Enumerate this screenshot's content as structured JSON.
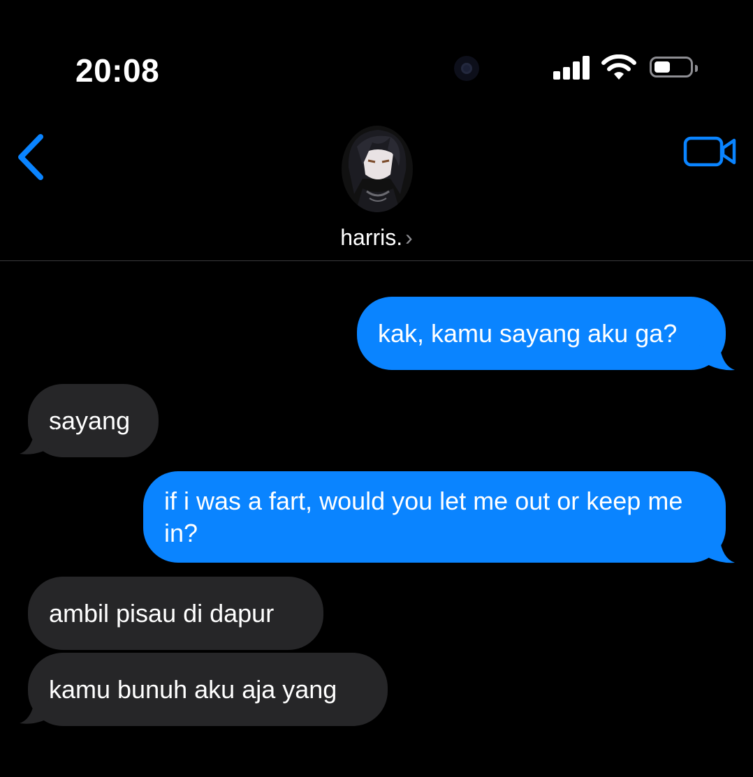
{
  "status_bar": {
    "time": "20:08",
    "icons": [
      "signal-icon",
      "wifi-icon",
      "battery-icon"
    ]
  },
  "header": {
    "contact_name": "harris.",
    "chevron": "›",
    "icons": [
      "back-chevron-icon",
      "video-call-icon",
      "contact-avatar"
    ]
  },
  "colors": {
    "accent": "#0a84ff",
    "sent_bubble": "#0a84ff",
    "received_bubble": "#262628",
    "background": "#000000"
  },
  "messages": [
    {
      "direction": "sent",
      "text": "kak, kamu sayang aku ga?"
    },
    {
      "direction": "received",
      "text": "sayang"
    },
    {
      "direction": "sent",
      "text": "if i was a fart, would you let me out or keep me in?"
    },
    {
      "direction": "received",
      "text": "ambil pisau di dapur"
    },
    {
      "direction": "received",
      "text": "kamu bunuh aku aja yang"
    }
  ]
}
